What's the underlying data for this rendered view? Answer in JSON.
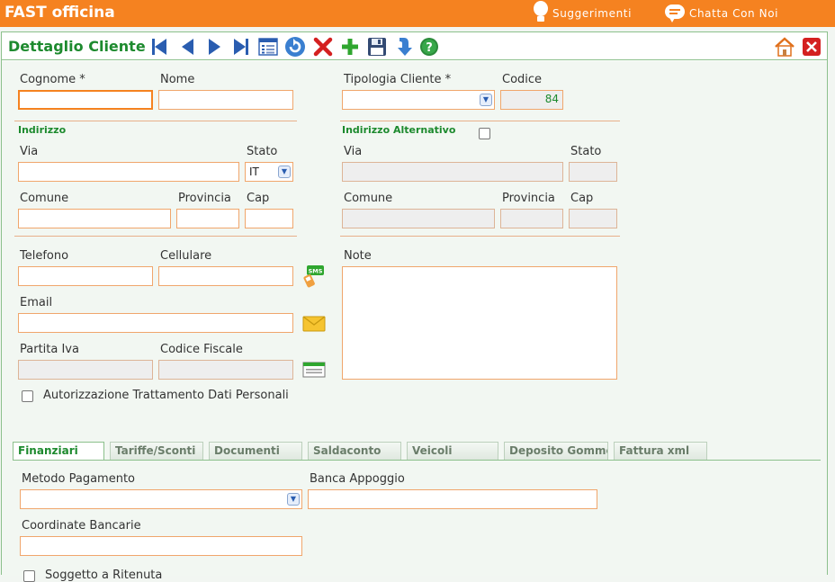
{
  "app": {
    "title": "FAST officina",
    "suggest": "Suggerimenti",
    "chat": "Chatta Con Noi"
  },
  "panel": {
    "title": "Dettaglio Cliente"
  },
  "toolbar": {
    "items": [
      "first-record-icon",
      "prev-record-icon",
      "next-record-icon",
      "last-record-icon",
      "list-icon",
      "refresh-icon",
      "delete-icon",
      "add-icon",
      "save-icon",
      "download-icon",
      "help-icon"
    ],
    "right": [
      "home-icon",
      "close-icon"
    ]
  },
  "form": {
    "cognome_label": "Cognome *",
    "nome_label": "Nome",
    "tipologia_label": "Tipologia Cliente *",
    "codice_label": "Codice",
    "codice_value": "84",
    "indirizzo_section": "Indirizzo",
    "indirizzo_alt_section": "Indirizzo Alternativo",
    "via_label": "Via",
    "stato_label": "Stato",
    "stato_value": "IT",
    "comune_label": "Comune",
    "provincia_label": "Provincia",
    "cap_label": "Cap",
    "telefono_label": "Telefono",
    "cellulare_label": "Cellulare",
    "note_label": "Note",
    "email_label": "Email",
    "piva_label": "Partita Iva",
    "cf_label": "Codice Fiscale",
    "privacy_label": "Autorizzazione Trattamento Dati Personali"
  },
  "tabs": [
    "Finanziari",
    "Tariffe/Sconti",
    "Documenti",
    "Saldaconto",
    "Veicoli",
    "Deposito Gomme",
    "Fattura xml"
  ],
  "finanziari": {
    "metodo_label": "Metodo Pagamento",
    "banca_label": "Banca Appoggio",
    "coordinate_label": "Coordinate Bancarie",
    "ritenuta_label": "Soggetto a Ritenuta"
  },
  "colors": {
    "brand": "#f58220",
    "accent": "#1d8a2e"
  }
}
